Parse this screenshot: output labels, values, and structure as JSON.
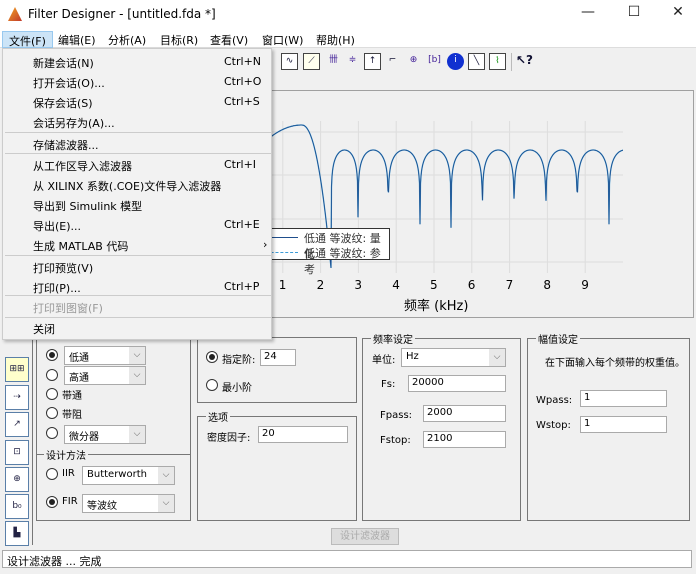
{
  "window": {
    "title": "Filter Designer -  [untitled.fda *]",
    "minimize": "—",
    "maximize": "☐",
    "close": "✕"
  },
  "menubar": [
    "文件(F)",
    "编辑(E)",
    "分析(A)",
    "目标(R)",
    "查看(V)",
    "窗口(W)",
    "帮助(H)"
  ],
  "file_menu": [
    {
      "label": "新建会话(N)",
      "shortcut": "Ctrl+N"
    },
    {
      "label": "打开会话(O)...",
      "shortcut": "Ctrl+O"
    },
    {
      "label": "保存会话(S)",
      "shortcut": "Ctrl+S"
    },
    {
      "label": "会话另存为(A)...",
      "shortcut": ""
    },
    {
      "label": "存储滤波器...",
      "shortcut": ""
    },
    {
      "label": "从工作区导入滤波器",
      "shortcut": "Ctrl+I"
    },
    {
      "label": "从 XILINX 系数(.COE)文件导入滤波器",
      "shortcut": ""
    },
    {
      "label": "导出到 Simulink 模型",
      "shortcut": ""
    },
    {
      "label": "导出(E)...",
      "shortcut": "Ctrl+E"
    },
    {
      "label": "生成 MATLAB 代码",
      "shortcut": "›"
    },
    {
      "label": "打印预览(V)",
      "shortcut": ""
    },
    {
      "label": "打印(P)...",
      "shortcut": "Ctrl+P"
    },
    {
      "label": "打印到图窗(F)",
      "shortcut": ""
    },
    {
      "label": "关闭",
      "shortcut": ""
    }
  ],
  "chart_data": {
    "type": "line",
    "xlabel": "频率 (kHz)",
    "xticks": [
      "1",
      "2",
      "3",
      "4",
      "5",
      "6",
      "7",
      "8",
      "9"
    ],
    "xlim": [
      0,
      10
    ],
    "series": [
      {
        "name": "低通 等波纹: 量化"
      },
      {
        "name": "低通 等波纹: 参考"
      }
    ],
    "passband_peak_khz": 1.5,
    "stopband_nulls_khz": [
      2.28,
      2.99,
      3.79,
      4.63,
      5.45,
      6.28,
      7.12,
      7.96,
      8.79,
      9.63
    ],
    "grid": true,
    "legend": "bottom-left"
  },
  "response_type": {
    "options": [
      "低通",
      "高通",
      "带通",
      "带阻",
      "微分器"
    ],
    "selected": "低通"
  },
  "design_method": {
    "label": "设计方法",
    "iir": "IIR",
    "iir_value": "Butterworth",
    "fir": "FIR",
    "fir_value": "等波纹",
    "selected": "FIR"
  },
  "order": {
    "specify": "指定阶:",
    "value": "24",
    "minimum": "最小阶"
  },
  "options": {
    "label": "选项",
    "density": "密度因子:",
    "density_value": "20"
  },
  "freq": {
    "label": "频率设定",
    "units_label": "单位:",
    "units": "Hz",
    "fs_label": "Fs:",
    "fs": "20000",
    "fpass_label": "Fpass:",
    "fpass": "2000",
    "fstop_label": "Fstop:",
    "fstop": "2100"
  },
  "mag": {
    "label": "幅值设定",
    "desc": "在下面输入每个频带的权重值。",
    "wpass_label": "Wpass:",
    "wpass": "1",
    "wstop_label": "Wstop:",
    "wstop": "1"
  },
  "design_button": "设计滤波器",
  "status": "设计滤波器 ... 完成",
  "colors": {
    "quantized": "#1f4e8c",
    "reference": "#3d9bd6"
  }
}
